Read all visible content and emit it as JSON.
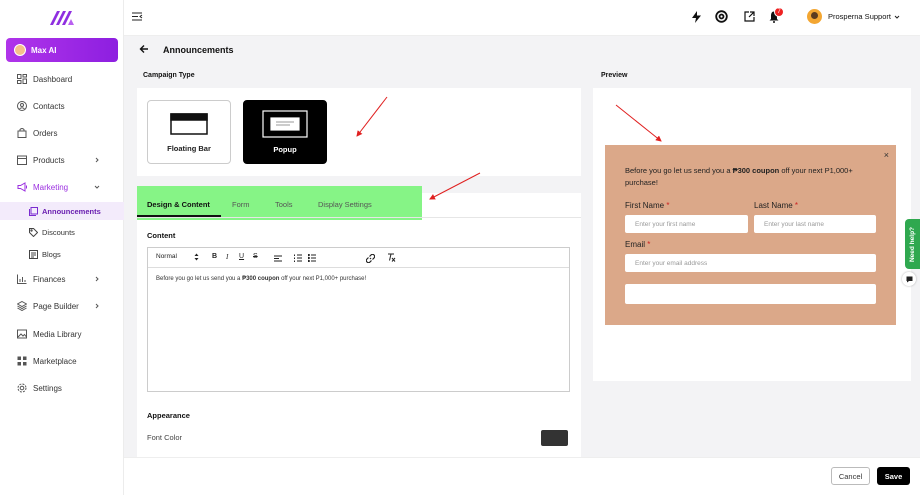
{
  "sidebar": {
    "max_ai": "Max AI",
    "items": [
      {
        "label": "Dashboard",
        "icon": "dashboard-icon"
      },
      {
        "label": "Contacts",
        "icon": "contacts-icon"
      },
      {
        "label": "Orders",
        "icon": "orders-icon"
      },
      {
        "label": "Products",
        "icon": "products-icon"
      },
      {
        "label": "Marketing",
        "icon": "marketing-icon"
      },
      {
        "label": "Finances",
        "icon": "finances-icon"
      },
      {
        "label": "Page Builder",
        "icon": "page-builder-icon"
      },
      {
        "label": "Media Library",
        "icon": "media-library-icon"
      },
      {
        "label": "Marketplace",
        "icon": "marketplace-icon"
      },
      {
        "label": "Settings",
        "icon": "settings-icon"
      }
    ],
    "marketing_sub": [
      {
        "label": "Announcements",
        "icon": "announcements-icon"
      },
      {
        "label": "Discounts",
        "icon": "discounts-icon"
      },
      {
        "label": "Blogs",
        "icon": "blogs-icon"
      }
    ]
  },
  "header": {
    "notification_count": "7",
    "user_name": "Prosperna Support"
  },
  "page": {
    "title": "Announcements"
  },
  "campaign": {
    "section_label": "Campaign Type",
    "options": [
      "Floating Bar",
      "Popup"
    ],
    "selected": "Popup"
  },
  "tabs": [
    "Design & Content",
    "Form",
    "Tools",
    "Display Settings"
  ],
  "content": {
    "label": "Content",
    "format": "Normal",
    "text_before": "Before you go let us send you a ",
    "text_bold": "₱300 coupon",
    "text_after": " off your next P1,000+ purchase!"
  },
  "appearance": {
    "label": "Appearance",
    "font_color_label": "Font Color",
    "font_color": "#333333"
  },
  "preview": {
    "label": "Preview",
    "close": "×",
    "msg_before": "Before you go let us send you a ",
    "msg_bold": "₱300 coupon",
    "msg_after": " off your next P1,000+ purchase!",
    "first_name_label": "First Name",
    "first_name_placeholder": "Enter your first name",
    "last_name_label": "Last Name",
    "last_name_placeholder": "Enter your last name",
    "email_label": "Email",
    "email_placeholder": "Enter your email address",
    "required_mark": "*",
    "background": "#dba889"
  },
  "help": {
    "label": "Need help?"
  },
  "footer": {
    "cancel": "Cancel",
    "save": "Save"
  },
  "colors": {
    "accent": "#9b2fe0",
    "highlight": "#86f486",
    "annotation": "#e02020"
  }
}
